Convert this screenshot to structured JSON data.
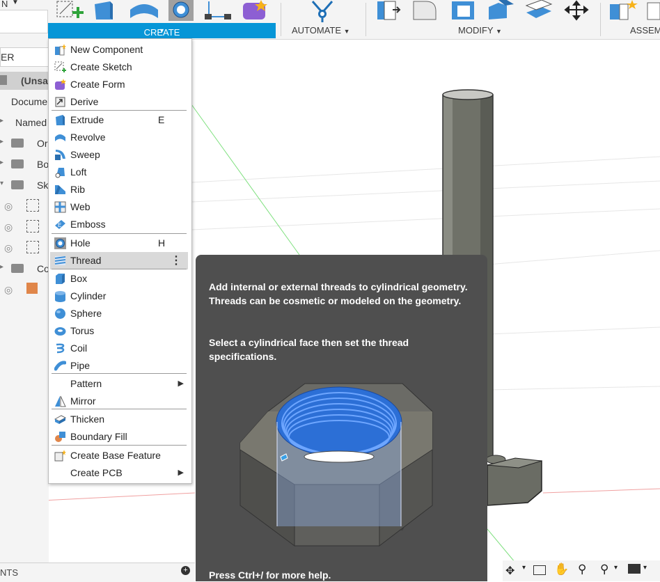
{
  "toolbar": {
    "design_label": "N",
    "create_label": "CREATE",
    "automate_label": "AUTOMATE",
    "modify_label": "MODIFY",
    "assemble_label": "ASSEM"
  },
  "browser": {
    "header": "ER",
    "root": "(Unsa",
    "document": "Docume",
    "named": "Named",
    "origin": "Or",
    "bodies": "Bo",
    "sketches": "Sk",
    "construction": "Co"
  },
  "menu": {
    "items": [
      {
        "label": "New Component",
        "shortcut": "",
        "icon": "new-component-icon"
      },
      {
        "label": "Create Sketch",
        "shortcut": "",
        "icon": "create-sketch-icon"
      },
      {
        "label": "Create Form",
        "shortcut": "",
        "icon": "create-form-icon"
      },
      {
        "label": "Derive",
        "shortcut": "",
        "icon": "derive-icon"
      },
      {
        "label": "Extrude",
        "shortcut": "E",
        "icon": "extrude-icon"
      },
      {
        "label": "Revolve",
        "shortcut": "",
        "icon": "revolve-icon"
      },
      {
        "label": "Sweep",
        "shortcut": "",
        "icon": "sweep-icon"
      },
      {
        "label": "Loft",
        "shortcut": "",
        "icon": "loft-icon"
      },
      {
        "label": "Rib",
        "shortcut": "",
        "icon": "rib-icon"
      },
      {
        "label": "Web",
        "shortcut": "",
        "icon": "web-icon"
      },
      {
        "label": "Emboss",
        "shortcut": "",
        "icon": "emboss-icon"
      },
      {
        "label": "Hole",
        "shortcut": "H",
        "icon": "hole-icon"
      },
      {
        "label": "Thread",
        "shortcut": "",
        "icon": "thread-icon"
      },
      {
        "label": "Box",
        "shortcut": "",
        "icon": "box-icon"
      },
      {
        "label": "Cylinder",
        "shortcut": "",
        "icon": "cylinder-icon"
      },
      {
        "label": "Sphere",
        "shortcut": "",
        "icon": "sphere-icon"
      },
      {
        "label": "Torus",
        "shortcut": "",
        "icon": "torus-icon"
      },
      {
        "label": "Coil",
        "shortcut": "",
        "icon": "coil-icon"
      },
      {
        "label": "Pipe",
        "shortcut": "",
        "icon": "pipe-icon"
      },
      {
        "label": "Pattern",
        "shortcut": "",
        "icon": ""
      },
      {
        "label": "Mirror",
        "shortcut": "",
        "icon": "mirror-icon"
      },
      {
        "label": "Thicken",
        "shortcut": "",
        "icon": "thicken-icon"
      },
      {
        "label": "Boundary Fill",
        "shortcut": "",
        "icon": "boundary-fill-icon"
      },
      {
        "label": "Create Base Feature",
        "shortcut": "",
        "icon": "create-base-feature-icon"
      },
      {
        "label": "Create PCB",
        "shortcut": "",
        "icon": ""
      }
    ]
  },
  "tooltip": {
    "description": "Add internal or external threads to cylindrical geometry. Threads can be cosmetic or modeled on the geometry.",
    "instruction": "Select a cylindrical face then set the thread specifications.",
    "help": "Press Ctrl+/ for more help."
  },
  "bottom": {
    "comments_label": "NTS"
  },
  "colors": {
    "accent": "#0696d7",
    "tooltip_bg": "#4f4f4f",
    "thread_blue": "#3d7fe0"
  }
}
